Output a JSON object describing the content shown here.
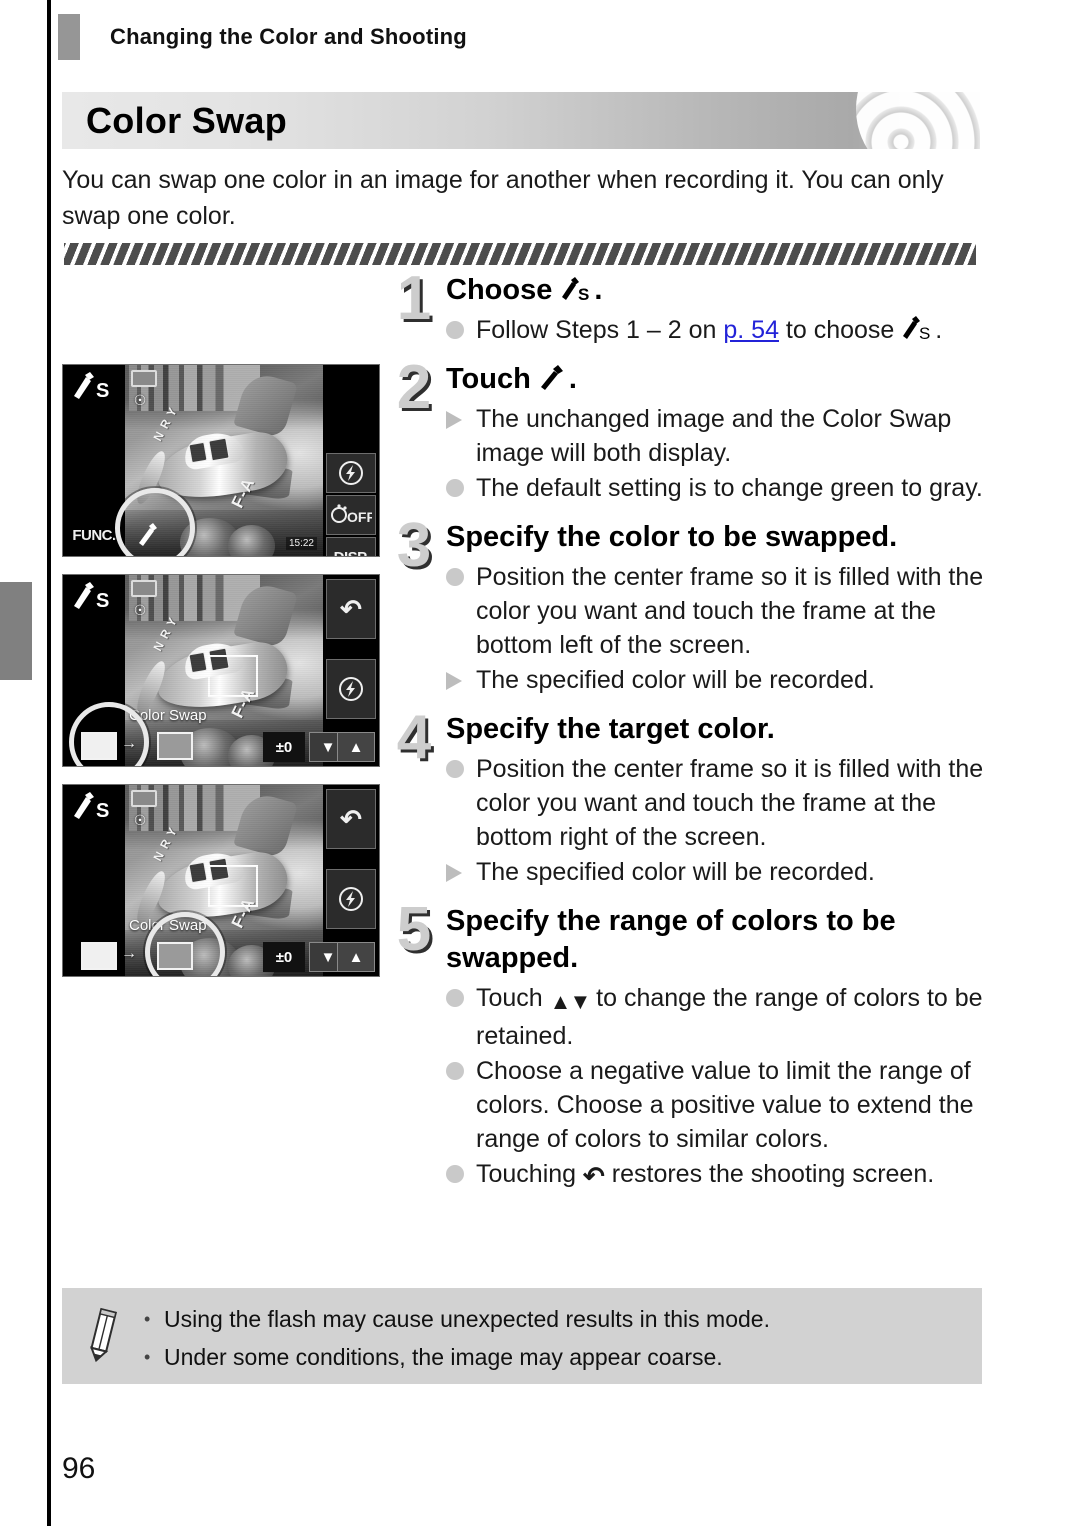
{
  "page": {
    "running_header": "Changing the Color and Shooting",
    "page_number": "96",
    "chapter_tab": ""
  },
  "title_banner": {
    "title": "Color Swap"
  },
  "intro": {
    "text": "You can swap one color in an image for another when recording it. You can only swap one color."
  },
  "steps": [
    {
      "number": "1",
      "title_prefix": "Choose",
      "title_icon": "color-swap-mode-icon",
      "title_suffix": ".",
      "bullets": [
        {
          "marker": "dot",
          "text_before_link": "Follow Steps 1 – 2 on ",
          "link": "p. 54",
          "text_after_link": " to choose ",
          "icon": "color-swap-mode-icon",
          "text_end": "."
        }
      ]
    },
    {
      "number": "2",
      "title_prefix": "Touch",
      "title_icon": "eyedropper-icon",
      "title_suffix": ".",
      "bullets": [
        {
          "marker": "triangle",
          "text": "The unchanged image and the Color Swap image will both display."
        },
        {
          "marker": "dot",
          "text": "The default setting is to change green to gray."
        }
      ]
    },
    {
      "number": "3",
      "title": "Specify the color to be swapped.",
      "bullets": [
        {
          "marker": "dot",
          "text": "Position the center frame so it is filled with the color you want and touch the frame at the bottom left of the screen."
        },
        {
          "marker": "triangle",
          "text": "The specified color will be recorded."
        }
      ]
    },
    {
      "number": "4",
      "title": "Specify the target color.",
      "bullets": [
        {
          "marker": "dot",
          "text": "Position the center frame so it is filled with the color you want and touch the frame at the bottom right of the screen."
        },
        {
          "marker": "triangle",
          "text": "The specified color will be recorded."
        }
      ]
    },
    {
      "number": "5",
      "title": "Specify the range of colors to be swapped.",
      "bullets": [
        {
          "marker": "dot",
          "text_before_icon": "Touch ",
          "icon": "up-down-arrows-icon",
          "text_after_icon": " to change the range of colors to be retained."
        },
        {
          "marker": "dot",
          "text": "Choose a negative value to limit the range of colors. Choose a positive value to extend the range of colors to similar colors."
        },
        {
          "marker": "dot",
          "text_before_icon": "Touching ",
          "icon": "back-arrow-icon",
          "text_after_icon": " restores the shooting screen."
        }
      ]
    }
  ],
  "screenshots": [
    {
      "name": "shot-step2-eyedropper",
      "mode_badge": "color-swap-mode-icon",
      "func_label": "FUNC.",
      "shots_remaining": "15:22",
      "right_buttons": [
        "flash-icon",
        "self-timer-off-icon",
        "DISP."
      ],
      "disp_label": "DISP.",
      "highlighted_control": "eyedropper-button"
    },
    {
      "name": "shot-step3-source-color",
      "mode_badge": "color-swap-mode-icon",
      "swap_label": "Color Swap",
      "arrow": "→",
      "value": "±0",
      "right_buttons": [
        "back-arrow-icon",
        "flash-icon"
      ],
      "down_label": "▼",
      "up_label": "▲",
      "highlighted_control": "source-color-swatch"
    },
    {
      "name": "shot-step4-target-color",
      "mode_badge": "color-swap-mode-icon",
      "swap_label": "Color Swap",
      "arrow": "→",
      "value": "±0",
      "right_buttons": [
        "back-arrow-icon",
        "flash-icon"
      ],
      "down_label": "▼",
      "up_label": "▲",
      "highlighted_control": "target-color-swatch"
    }
  ],
  "note": {
    "items": [
      "Using the flash may cause unexpected results in this mode.",
      "Under some conditions, the image may appear coarse."
    ]
  }
}
